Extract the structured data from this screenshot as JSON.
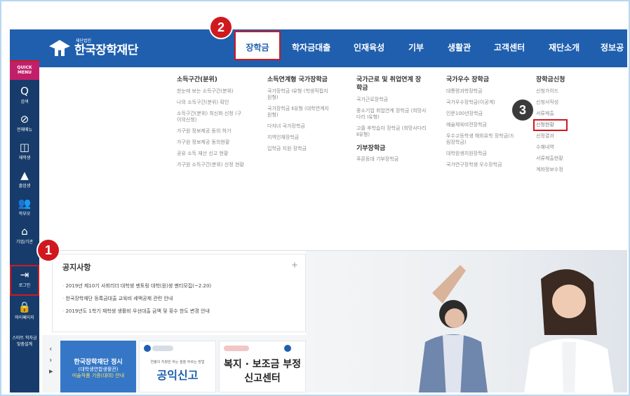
{
  "header": {
    "logo_small": "재단법인",
    "logo_main": "한국장학재단",
    "nav": [
      "장학금",
      "학자금대출",
      "인재육성",
      "기부",
      "생활관",
      "고객센터",
      "재단소개",
      "정보공"
    ],
    "active_nav": "장학금"
  },
  "markers": {
    "one": "1",
    "two": "2",
    "three": "3"
  },
  "quick_menu": {
    "title": "QUICK MENU",
    "items": [
      {
        "icon": "search-icon",
        "glyph": "Q",
        "label": "검색"
      },
      {
        "icon": "compass-icon",
        "glyph": "⊘",
        "label": "전체메뉴"
      },
      {
        "icon": "book-icon",
        "glyph": "◫",
        "label": "재학생"
      },
      {
        "icon": "graduation-icon",
        "glyph": "▲",
        "label": "졸업생"
      },
      {
        "icon": "people-icon",
        "glyph": "👥",
        "label": "학부모"
      },
      {
        "icon": "bank-icon",
        "glyph": "⌂",
        "label": "기업/기관"
      },
      {
        "icon": "login-icon",
        "glyph": "⇥",
        "label": "로그인"
      },
      {
        "icon": "lock-icon",
        "glyph": "🔒",
        "label": "마이페이지"
      },
      {
        "icon": "smart-icon",
        "glyph": "",
        "label": "스마트 학자금 맞춤설계"
      }
    ]
  },
  "mega_menu": {
    "columns": [
      {
        "head": "소득구간(분위)",
        "items": [
          "한눈에 보는 소득구간(분위)",
          "나의 소득구간(분위) 확인",
          "소득구간(분위) 최신화 신청 (구 이의신청)",
          "가구원 정보제공 동의 하기",
          "가구원 정보제공 동의현황",
          "공유 소득 재산 신고 현황",
          "가구원 소득구간(분위) 산정 현황"
        ]
      },
      {
        "head": "소득연계형 국가장학금",
        "items": [
          "국가장학금 Ⅰ유형 (학생직접지원형)",
          "국가장학금 Ⅱ유형 (대학연계지원형)",
          "다자녀 국가장학금",
          "지역인재장학금",
          "입학금 지원 장학금"
        ]
      },
      {
        "head": "국가근로 및 취업연계 장학금",
        "items": [
          "국가근로장학금",
          "중소기업 취업연계 장학금 (희망사다리 Ⅰ유형)",
          "고졸 후학습자 장학금 (희망사다리 Ⅱ유형)"
        ],
        "sub_head": "기부장학금",
        "sub_items": [
          "푸른등대 기부장학금"
        ]
      },
      {
        "head": "국가우수 장학금",
        "items": [
          "대통령과학장학금",
          "국가우수장학금(이공계)",
          "인문100년장학금",
          "예술체육비전장학금",
          "우수고등학생 해외유학 장학금(드림장학금)",
          "대학원생지원장학금",
          "국가연구장학생 우수장학금"
        ]
      },
      {
        "head": "장학금신청",
        "items": [
          "신청가이드",
          "신청서작성",
          "서류제출",
          "신청현황",
          "선정결과",
          "수혜내역",
          "서류제출현황",
          "계좌정보수정"
        ]
      }
    ]
  },
  "notice": {
    "title": "공지사항",
    "more": "+",
    "items": [
      "2019년 제10기 사회리더 대학생 멘토링 대학(원)생 멘티모집(~2.20)",
      "한국장학재단 등록금대출 교육비 세액공제 관련 안내",
      "2019년도 1학기 재학생 생활비 우선대출 금액 및 횟수 한도 변경 안내"
    ]
  },
  "banners": {
    "arrows": [
      "‹",
      "›",
      "▸"
    ],
    "b1": {
      "title": "한국장학재단 정시",
      "sub": "(대학생연합생활관)",
      "tag": "미술작품 기증(대여) 안내"
    },
    "b2": {
      "small": "연봉이 지정한 하는 쏠쏠 부르는 방법",
      "big": "공익신고"
    },
    "b3": {
      "top": "복지 · 보조금 부정",
      "bot": "신고센터"
    }
  }
}
